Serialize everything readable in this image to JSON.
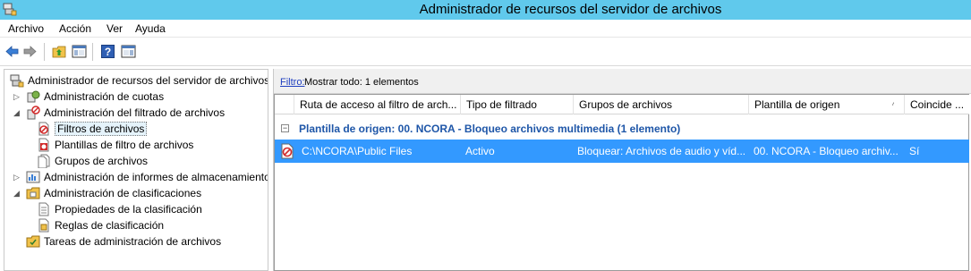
{
  "window": {
    "title": "Administrador de recursos del servidor de archivos",
    "titlebar_color": "#60c9ec"
  },
  "menu": [
    "Archivo",
    "Acción",
    "Ver",
    "Ayuda"
  ],
  "toolbar": {
    "icons": [
      "back-arrow-icon",
      "forward-arrow-icon",
      "up-folder-icon",
      "show-hide-console-tree-icon",
      "help-icon",
      "show-hide-action-pane-icon"
    ]
  },
  "tree": {
    "root": "Administrador de recursos del servidor de archivos",
    "items": [
      {
        "label": "Administración de cuotas",
        "icon": "quota-icon"
      },
      {
        "label": "Administración del filtrado de archivos",
        "icon": "file-screening-icon"
      },
      {
        "label": "Filtros de archivos",
        "icon": "file-screen-icon"
      },
      {
        "label": "Plantillas de filtro de archivos",
        "icon": "screen-template-icon"
      },
      {
        "label": "Grupos de archivos",
        "icon": "file-group-icon"
      },
      {
        "label": "Administración de informes de almacenamiento",
        "icon": "storage-report-icon"
      },
      {
        "label": "Administración de clasificaciones",
        "icon": "classification-icon"
      },
      {
        "label": "Propiedades de la clasificación",
        "icon": "properties-icon"
      },
      {
        "label": "Reglas de clasificación",
        "icon": "rules-icon"
      },
      {
        "label": "Tareas de administración de archivos",
        "icon": "tasks-icon"
      }
    ]
  },
  "filter": {
    "link": "Filtro:",
    "text": "Mostrar todo: 1 elementos"
  },
  "list": {
    "columns": [
      "Ruta de acceso al filtro de arch...",
      "Tipo de filtrado",
      "Grupos de archivos",
      "Plantilla de origen",
      "Coincide ..."
    ],
    "group_title": "Plantilla de origen: 00. NCORA - Bloqueo archivos multimedia (1 elemento)",
    "rows": [
      {
        "path": "C:\\NCORA\\Public Files",
        "type": "Activo",
        "groups": "Bloquear: Archivos de audio y víd...",
        "template": "00. NCORA - Bloqueo archiv...",
        "match": "Sí"
      }
    ],
    "selected_color": "#3399ff",
    "group_color": "#1e56a8"
  }
}
